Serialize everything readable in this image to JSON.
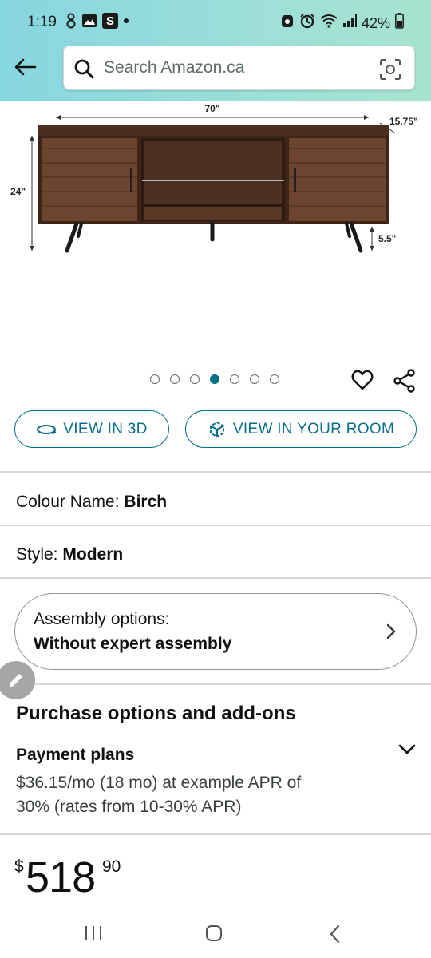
{
  "status_bar": {
    "time": "1:19",
    "battery": "42%",
    "left_icons": [
      "person-icon",
      "image-icon",
      "s-app-icon",
      "dot-icon"
    ],
    "right_icons": [
      "alarm-clock-icon",
      "alarm-icon",
      "wifi-icon",
      "signal-icon",
      "battery-icon"
    ]
  },
  "header": {
    "search_placeholder": "Search Amazon.ca",
    "back_icon": "arrow-left-icon",
    "search_icon": "search-icon",
    "camera_icon": "camera-scan-icon",
    "accent": "#86d6e0"
  },
  "product_image": {
    "dim_width": "70\"",
    "dim_depth": "15.75\"",
    "dim_height": "24\"",
    "dim_leg": "5.5\""
  },
  "carousel": {
    "count": 7,
    "active_index": 3,
    "active_color": "#007185"
  },
  "actions": {
    "view_3d": "VIEW IN 3D",
    "view_room": "VIEW IN YOUR ROOM"
  },
  "colour": {
    "label": "Colour Name:",
    "value": "Birch"
  },
  "style": {
    "label": "Style:",
    "value": "Modern"
  },
  "assembly": {
    "line1": "Assembly options:",
    "line2": "Without expert assembly"
  },
  "purchase": {
    "title": "Purchase options and add-ons",
    "payment_title": "Payment plans",
    "payment_text": "$36.15/mo (18 mo) at example APR of 30% (rates from 10-30% APR)"
  },
  "price": {
    "currency": "$",
    "whole": "518",
    "fraction": "90"
  }
}
